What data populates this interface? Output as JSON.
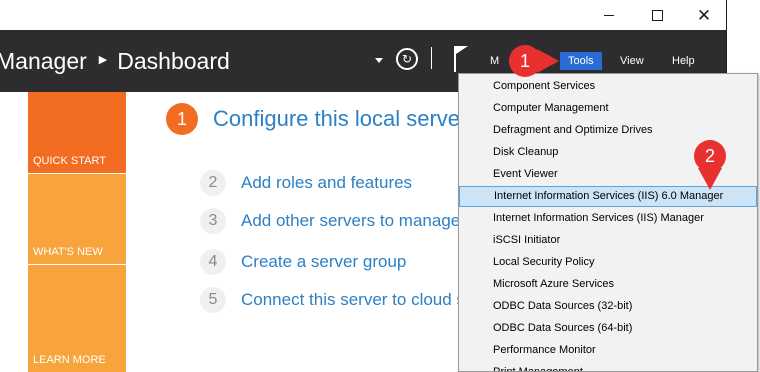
{
  "header": {
    "breadcrumb_app": "Manager",
    "breadcrumb_page": "Dashboard",
    "menu": {
      "manage": "M",
      "tools": "Tools",
      "view": "View",
      "help": "Help"
    }
  },
  "tiles": {
    "quick_start": "QUICK START",
    "whats_new": "WHAT'S NEW",
    "learn_more": "LEARN MORE"
  },
  "steps": {
    "main": {
      "number": "1",
      "text": "Configure this local server"
    },
    "items": [
      {
        "number": "2",
        "text": "Add roles and features"
      },
      {
        "number": "3",
        "text": "Add other servers to manage"
      },
      {
        "number": "4",
        "text": "Create a server group"
      },
      {
        "number": "5",
        "text": "Connect this server to cloud services"
      }
    ]
  },
  "tools_menu": {
    "items": [
      {
        "label": "Component Services"
      },
      {
        "label": "Computer Management"
      },
      {
        "label": "Defragment and Optimize Drives"
      },
      {
        "label": "Disk Cleanup"
      },
      {
        "label": "Event Viewer"
      },
      {
        "label": "Internet Information Services (IIS) 6.0 Manager"
      },
      {
        "label": "Internet Information Services (IIS) Manager"
      },
      {
        "label": "iSCSI Initiator"
      },
      {
        "label": "Local Security Policy"
      },
      {
        "label": "Microsoft Azure Services"
      },
      {
        "label": "ODBC Data Sources (32-bit)"
      },
      {
        "label": "ODBC Data Sources (64-bit)"
      },
      {
        "label": "Performance Monitor"
      },
      {
        "label": "Print Management"
      }
    ],
    "highlighted_index": 5
  },
  "callouts": {
    "one": "1",
    "two": "2"
  },
  "colors": {
    "header_bg": "#2d2d30",
    "tools_active": "#2a6bd6",
    "quick_start_tile": "#f26d21",
    "secondary_tiles": "#f7a43c",
    "link_blue": "#2c80c5",
    "callout_red": "#e8312f",
    "menu_highlight": "#cce4f6"
  }
}
